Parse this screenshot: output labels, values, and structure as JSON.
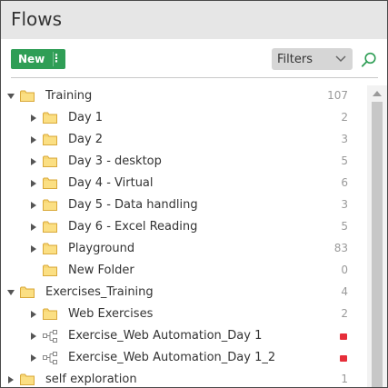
{
  "header": {
    "title": "Flows"
  },
  "toolbar": {
    "new_label": "New",
    "new_menu_glyph": "⋮",
    "filters_label": "Filters"
  },
  "icons": {
    "folder": "folder-icon",
    "flow": "flow-icon",
    "search": "search-icon",
    "chevron": "chevron-down-icon",
    "expand": "expand-arrow-icon",
    "collapse": "collapse-arrow-icon"
  },
  "colors": {
    "accent_green": "#2f9e56",
    "status_red": "#e62e3a",
    "folder_yellow": "#f8d775"
  },
  "tree": [
    {
      "label": "Training",
      "count": "107",
      "level": 0,
      "kind": "folder",
      "expanded": true,
      "arrow": true
    },
    {
      "label": "Day 1",
      "count": "2",
      "level": 1,
      "kind": "folder",
      "arrow": true
    },
    {
      "label": "Day 2",
      "count": "3",
      "level": 1,
      "kind": "folder",
      "arrow": true
    },
    {
      "label": "Day 3 - desktop",
      "count": "5",
      "level": 1,
      "kind": "folder",
      "arrow": true
    },
    {
      "label": "Day 4 - Virtual",
      "count": "6",
      "level": 1,
      "kind": "folder",
      "arrow": true
    },
    {
      "label": "Day 5 - Data handling",
      "count": "3",
      "level": 1,
      "kind": "folder",
      "arrow": true
    },
    {
      "label": "Day 6 - Excel Reading",
      "count": "5",
      "level": 1,
      "kind": "folder",
      "arrow": true
    },
    {
      "label": "Playground",
      "count": "83",
      "level": 1,
      "kind": "folder",
      "arrow": true
    },
    {
      "label": "New Folder",
      "count": "0",
      "level": 1,
      "kind": "folder",
      "arrow": false
    },
    {
      "label": "Exercises_Training",
      "count": "4",
      "level": 0,
      "kind": "folder",
      "expanded": true,
      "arrow": true
    },
    {
      "label": "Web Exercises",
      "count": "2",
      "level": 1,
      "kind": "folder",
      "arrow": true
    },
    {
      "label": "Exercise_Web Automation_Day 1",
      "count": "",
      "level": 1,
      "kind": "flow",
      "arrow": true,
      "status": true
    },
    {
      "label": "Exercise_Web Automation_Day 1_2",
      "count": "",
      "level": 1,
      "kind": "flow",
      "arrow": true,
      "status": true
    },
    {
      "label": "self exploration",
      "count": "1",
      "level": 0,
      "kind": "folder",
      "arrow": true
    }
  ]
}
